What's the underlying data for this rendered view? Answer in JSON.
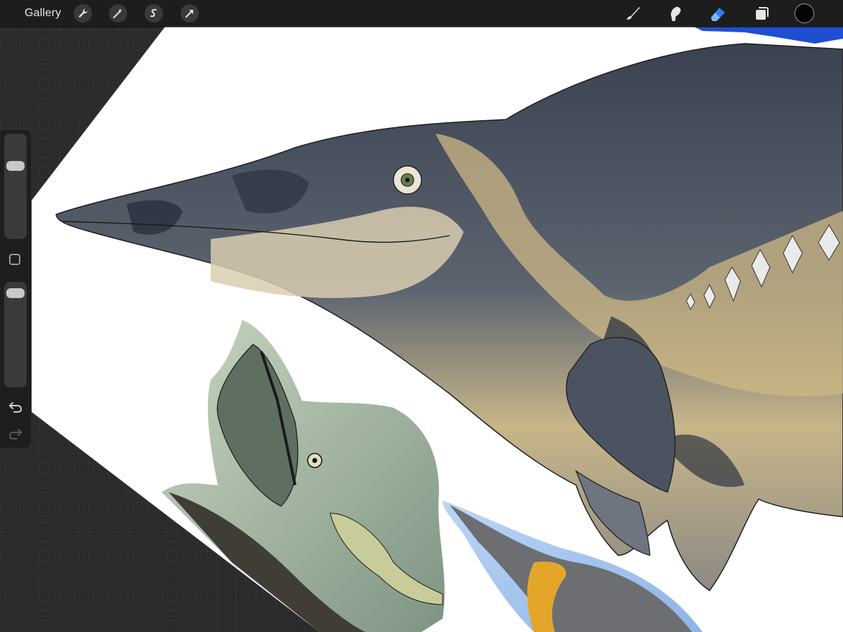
{
  "toolbar": {
    "gallery_label": "Gallery",
    "left_tools": [
      "wrench-icon",
      "magic-wand-icon",
      "selection-icon",
      "transform-arrow-icon"
    ],
    "right_tools": [
      "brush-icon",
      "smudge-icon",
      "eraser-icon",
      "layers-icon"
    ],
    "active_tool": "eraser-icon",
    "current_color": "#050505"
  },
  "sidebar": {
    "brush_size_level": 0.27,
    "opacity_level": 0.03,
    "controls": [
      "brush-size-slider",
      "modify-button",
      "opacity-slider",
      "undo-icon",
      "redo-icon"
    ]
  },
  "colors": {
    "accent_active": "#2f7df6",
    "toolbar_bg": "#1d1d1d",
    "canvas_bg": "#ffffff"
  }
}
